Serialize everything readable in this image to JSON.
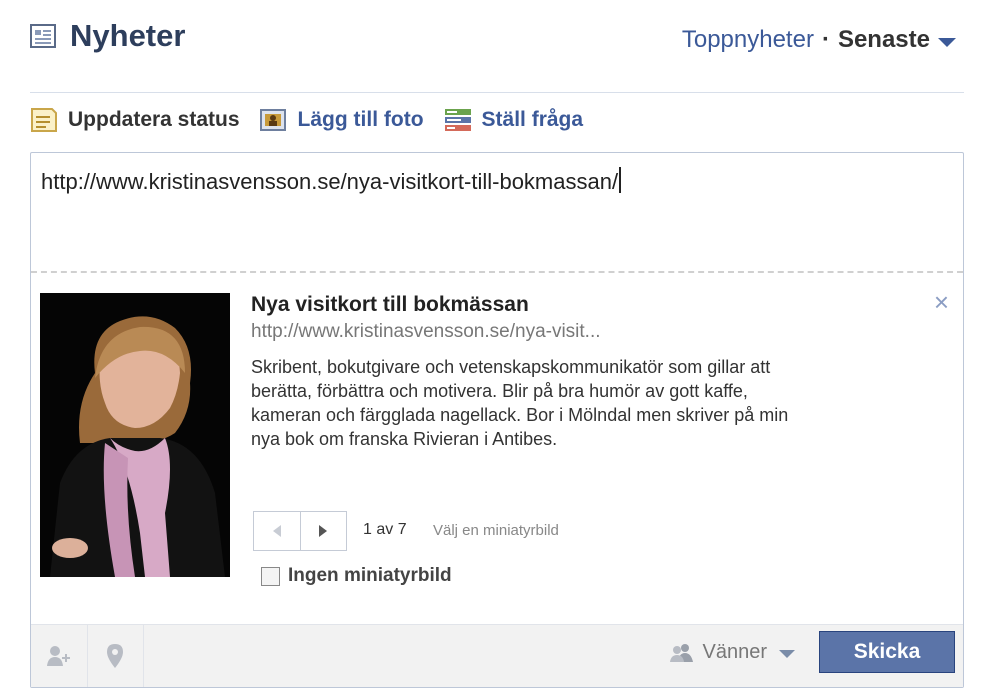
{
  "header": {
    "title": "Nyheter",
    "sort_top": "Toppnyheter",
    "sort_separator": "·",
    "sort_latest": "Senaste"
  },
  "composer_tabs": [
    {
      "label": "Uppdatera status",
      "icon": "status-icon"
    },
    {
      "label": "Lägg till foto",
      "icon": "photo-icon"
    },
    {
      "label": "Ställ fråga",
      "icon": "question-icon"
    }
  ],
  "composer": {
    "text": "http://www.kristinasvensson.se/nya-visitkort-till-bokmassan/"
  },
  "link_preview": {
    "title": "Nya visitkort till bokmässan",
    "url": "http://www.kristinasvensson.se/nya-visit...",
    "description": "Skribent, bokutgivare och vetenskapskommunikatör som gillar att berätta, förbättra och motivera. Blir på bra humör av gott kaffe, kameran och färgglada nagellack. Bor i Mölndal men skriver på min nya bok om franska Rivieran i Antibes.",
    "thumb_counter": "1 av 7",
    "choose_thumb": "Välj en miniatyrbild",
    "no_thumb_label": "Ingen miniatyrbild",
    "close_symbol": "×"
  },
  "footer": {
    "audience": "Vänner",
    "submit": "Skicka"
  },
  "colors": {
    "brand": "#3b5998",
    "button": "#5b74a8"
  }
}
